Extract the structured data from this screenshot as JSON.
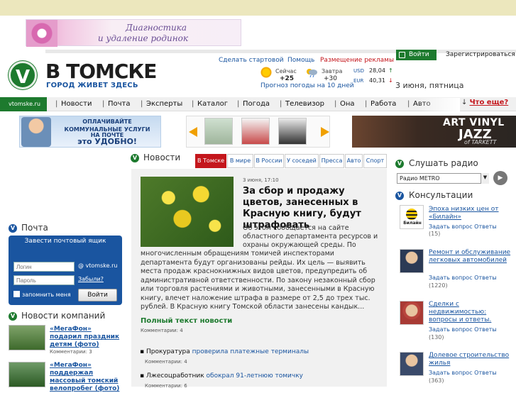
{
  "banner_top": {
    "line1": "Диагностика",
    "line2": "и удаление родинок"
  },
  "logo": {
    "letter": "V",
    "title": "В ТОМСКЕ",
    "slogan": "ГОРОД ЖИВЕТ ЗДЕСЬ"
  },
  "top_links": {
    "start": "Сделать стартовой",
    "help": "Помощь",
    "ads": "Размещение рекламы"
  },
  "auth": {
    "login": "Войти",
    "register": "Зарегистрироваться"
  },
  "weather": {
    "now_label": "Сейчас",
    "now_temp": "+25",
    "tomorrow_label": "Завтра",
    "tomorrow_temp": "+30",
    "forecast_link": "Прогноз погоды на 10 дней"
  },
  "currency": {
    "usd_label": "USD",
    "usd_value": "28,04",
    "usd_dir": "↑",
    "eur_label": "EUR",
    "eur_value": "40,31",
    "eur_dir": "↓"
  },
  "date": "3 июня, пятница",
  "nav": {
    "site": "vtomske.ru",
    "items": [
      "Новости",
      "Почта",
      "Эксперты",
      "Каталог",
      "Погода",
      "Телевизор",
      "Она",
      "Работа",
      "Авто"
    ],
    "what": "Что еще?"
  },
  "banner_kommun": {
    "line1": "ОПЛАЧИВАЙТЕ",
    "line2": "КОММУНАЛЬНЫЕ УСЛУГИ",
    "line3": "НА ПОЧТЕ",
    "line4": "это УДОБНО!"
  },
  "banner_vinyl": {
    "line1": "ART VINYL",
    "line2": "JAZZ",
    "line3": "of TARKETT"
  },
  "news": {
    "title": "Новости",
    "tabs": [
      "В Томске",
      "В мире",
      "В России",
      "У соседей",
      "Пресса",
      "Авто",
      "Спорт"
    ],
    "meta": "3 июня, 17:10",
    "headline": "За сбор и продажу цветов, занесенных в Красную книгу, будут штрафовать",
    "lead_part1": "Об этом сообщается на сайте областного департамента ресурсов и охраны окружающей среды. По",
    "lead_part2": "многочисленным обращениям томичей инспекторами департамента будут организованы рейды. Их цель — выявить места продаж краснокнижных видов цветов, предупредить об административной ответственности. По закону незаконный сбор или торговля растениями и животными, занесенными в Красную книгу, влечет наложение штрафа в размере от 2,5 до трех тыс. рублей. В Красную книгу Томской области занесены кандык...",
    "full_link": "Полный текст новости",
    "comments": "Комментарии: 4",
    "small": [
      {
        "prefix": "Прокуратура",
        "link": "проверила платежные терминалы",
        "comments": "Комментарии: 4"
      },
      {
        "prefix": "Лжесоцработник",
        "link": "обокрал 91-летнюю томичку",
        "comments": "Комментарии: 6"
      }
    ]
  },
  "mail": {
    "title": "Почта",
    "create": "Завести почтовый ящик",
    "login_ph": "Логин",
    "domain": "@ vtomske.ru",
    "pass_ph": "Пароль",
    "forgot": "Забыли?",
    "remember": "запомнить меня",
    "submit": "Войти"
  },
  "companies": {
    "title": "Новости компаний",
    "items": [
      {
        "text": "«МегаФон» подарил праздник детям (фото)",
        "comments": "Комментарии: 3"
      },
      {
        "text": "«МегаФон» поддержал массовый томский велопробег (фото)",
        "comments": ""
      }
    ]
  },
  "radio": {
    "title": "Слушать радио",
    "station": "Радио METRO"
  },
  "consult": {
    "title": "Консультации",
    "items": [
      {
        "title": "Эпоха низких цен от «Билайн»",
        "ask": "Задать вопрос",
        "answers": "Ответы",
        "count": "(15)",
        "logo": "Билайн"
      },
      {
        "title": "Ремонт и обслуживание легковых автомобилей",
        "ask": "Задать вопрос",
        "answers": "Ответы",
        "count": "(1220)"
      },
      {
        "title": "Сделки с недвижимостью: вопросы и ответы.",
        "ask": "Задать вопрос",
        "answers": "Ответы",
        "count": "(130)"
      },
      {
        "title": "Долевое строительство жилья",
        "ask": "Задать вопрос",
        "answers": "Ответы",
        "count": "(363)"
      }
    ]
  }
}
